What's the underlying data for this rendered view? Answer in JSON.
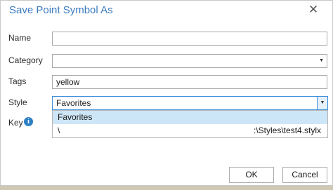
{
  "dialog": {
    "title": "Save Point Symbol As",
    "close_icon": "close-icon",
    "fields": {
      "name": {
        "label": "Name",
        "value": ""
      },
      "category": {
        "label": "Category",
        "value": ""
      },
      "tags": {
        "label": "Tags",
        "value": "yellow"
      },
      "style": {
        "label": "Style",
        "value": "Favorites"
      },
      "key": {
        "label": "Key"
      }
    },
    "style_options": [
      "Favorites",
      "\\",
      ":\\Styles\\test4.stylx"
    ],
    "buttons": {
      "ok": "OK",
      "cancel": "Cancel"
    }
  }
}
